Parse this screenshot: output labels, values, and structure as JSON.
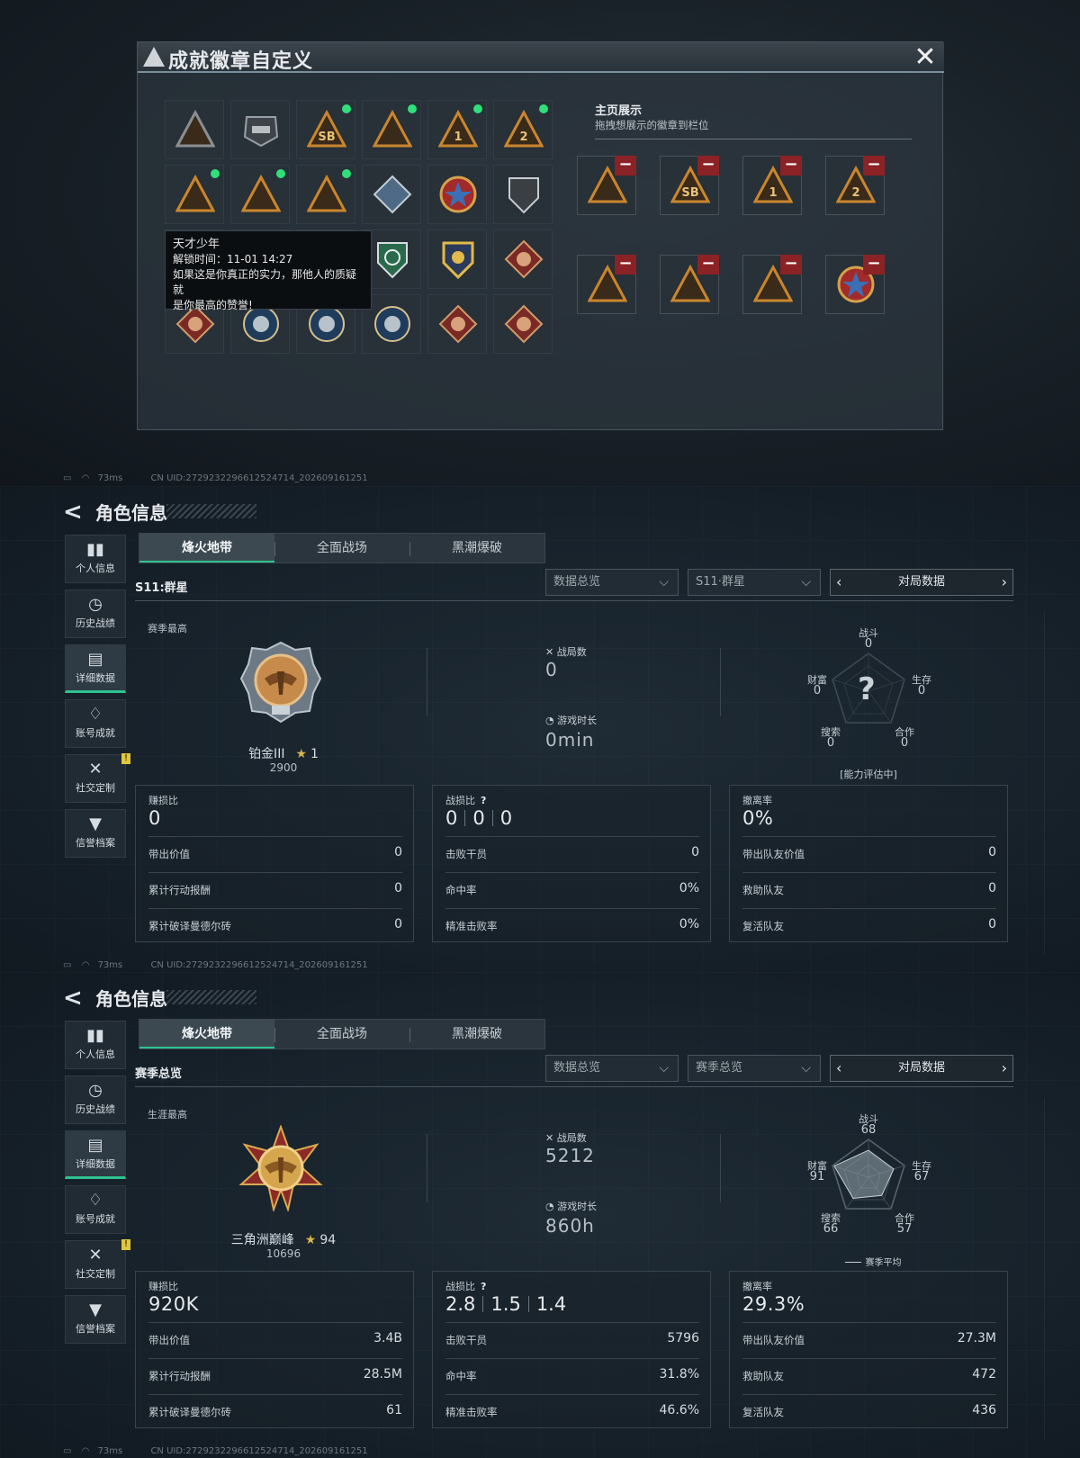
{
  "dialog": {
    "title": "成就徽章自定义",
    "display_title": "主页展示",
    "display_sub": "拖拽想展示的徽章到栏位",
    "tooltip": {
      "title": "天才少年",
      "unlock": "解锁时间：11-01 14:27",
      "line1": "如果这是你真正的实力，那他人的质疑就",
      "line2": "是你最高的赞誉!"
    },
    "slot_texts": [
      "SB",
      "1",
      "2"
    ]
  },
  "statusbar": {
    "ping": "73ms",
    "uid": "CN UID:27292322966125247​14_202609161251"
  },
  "panel1": {
    "title": "角色信息",
    "sidebar": [
      {
        "label": "个人信息"
      },
      {
        "label": "历史战绩"
      },
      {
        "label": "详细数据"
      },
      {
        "label": "账号成就"
      },
      {
        "label": "社交定制"
      },
      {
        "label": "信誉档案"
      }
    ],
    "tabs": [
      "烽火地带",
      "全面战场",
      "黑潮爆破"
    ],
    "season_label": "S11:群星",
    "dropdown1": "数据总览",
    "dropdown2": "S11·群星",
    "pager": "对局数据",
    "best_label": "赛季最高",
    "rank_name": "铂金III",
    "rank_stars": "1",
    "rank_score": "2900",
    "matches_label": "战局数",
    "matches_value": "0",
    "playtime_label": "游戏时长",
    "playtime_value": "0min",
    "radar": {
      "combat_label": "战斗",
      "combat": "0",
      "survive_label": "生存",
      "survive": "0",
      "coop_label": "合作",
      "coop": "0",
      "search_label": "搜索",
      "search": "0",
      "wealth_label": "财富",
      "wealth": "0",
      "center": "?",
      "note": "[能力评估中]"
    },
    "box1": {
      "head": "赚损比",
      "big": "0",
      "rows": [
        [
          "带出价值",
          "0"
        ],
        [
          "累计行动报酬",
          "0"
        ],
        [
          "累计破译曼德尔砖",
          "0"
        ]
      ]
    },
    "box2": {
      "head": "战损比",
      "kd": [
        "0",
        "0",
        "0"
      ],
      "rows": [
        [
          "击败干员",
          "0"
        ],
        [
          "命中率",
          "0%"
        ],
        [
          "精准击败率",
          "0%"
        ]
      ]
    },
    "box3": {
      "head": "撤离率",
      "big": "0%",
      "rows": [
        [
          "带出队友价值",
          "0"
        ],
        [
          "救助队友",
          "0"
        ],
        [
          "复活队友",
          "0"
        ]
      ]
    }
  },
  "panel2": {
    "title": "角色信息",
    "tabs": [
      "烽火地带",
      "全面战场",
      "黑潮爆破"
    ],
    "season_label": "赛季总览",
    "dropdown1": "数据总览",
    "dropdown2": "赛季总览",
    "pager": "对局数据",
    "best_label": "生涯最高",
    "rank_name": "三角洲巅峰",
    "rank_stars": "94",
    "rank_score": "10696",
    "matches_label": "战局数",
    "matches_value": "5212",
    "playtime_label": "游戏时长",
    "playtime_value": "860h",
    "radar": {
      "combat_label": "战斗",
      "combat": "68",
      "survive_label": "生存",
      "survive": "67",
      "coop_label": "合作",
      "coop": "57",
      "search_label": "搜索",
      "search": "66",
      "wealth_label": "财富",
      "wealth": "91",
      "legend": "赛季平均"
    },
    "radar_values": {
      "combat": 68,
      "survive": 67,
      "coop": 57,
      "search": 66,
      "wealth": 91
    },
    "box1": {
      "head": "赚损比",
      "big": "920K",
      "rows": [
        [
          "带出价值",
          "3.4B"
        ],
        [
          "累计行动报酬",
          "28.5M"
        ],
        [
          "累计破译曼德尔砖",
          "61"
        ]
      ]
    },
    "box2": {
      "head": "战损比",
      "kd": [
        "2.8",
        "1.5",
        "1.4"
      ],
      "rows": [
        [
          "击败干员",
          "5796"
        ],
        [
          "命中率",
          "31.8%"
        ],
        [
          "精准击败率",
          "46.6%"
        ]
      ]
    },
    "box3": {
      "head": "撤离率",
      "big": "29.3%",
      "rows": [
        [
          "带出队友价值",
          "27.3M"
        ],
        [
          "救助队友",
          "472"
        ],
        [
          "复活队友",
          "436"
        ]
      ]
    }
  },
  "colors": {
    "accent": "#2ec28e",
    "badge_gold": "#c9a24a",
    "remove_red": "#8b2226",
    "new_dot": "#2fe07a"
  }
}
